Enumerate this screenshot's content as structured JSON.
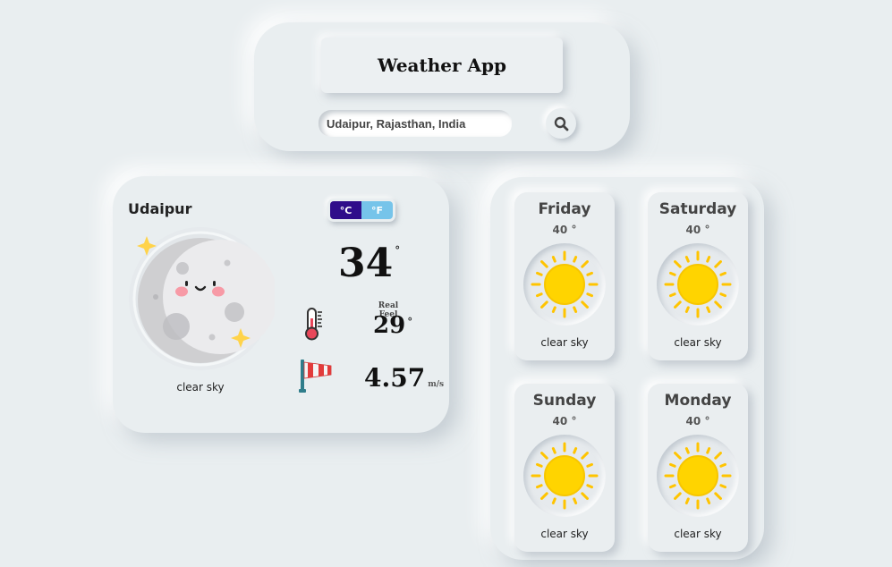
{
  "header": {
    "title": "Weather App",
    "search": {
      "value": "Udaipur, Rajasthan, India",
      "placeholder": ""
    },
    "search_icon": "search-icon"
  },
  "current": {
    "city": "Udaipur",
    "icon": "crescent-moon-icon",
    "description": "clear sky",
    "units": {
      "celsius": "°C",
      "fahrenheit": "°F",
      "selected": "°C"
    },
    "temperature": "34",
    "degree_symbol": "°",
    "real_feel_label": "Real Feel",
    "real_feel": "29",
    "wind_speed": "4.57",
    "wind_unit": "m/s",
    "thermometer_icon": "thermometer-icon",
    "wind_icon": "windsock-icon"
  },
  "forecast": [
    {
      "day": "Friday",
      "temp": "40",
      "deg": "°",
      "description": "clear sky",
      "icon": "sun-icon"
    },
    {
      "day": "Saturday",
      "temp": "40",
      "deg": "°",
      "description": "clear sky",
      "icon": "sun-icon"
    },
    {
      "day": "Sunday",
      "temp": "40",
      "deg": "°",
      "description": "clear sky",
      "icon": "sun-icon"
    },
    {
      "day": "Monday",
      "temp": "40",
      "deg": "°",
      "description": "clear sky",
      "icon": "sun-icon"
    }
  ],
  "colors": {
    "background": "#e9eef0",
    "celsius_active": "#2f0d8a",
    "fahrenheit": "#76c4ea",
    "sun": "#ffd400"
  }
}
